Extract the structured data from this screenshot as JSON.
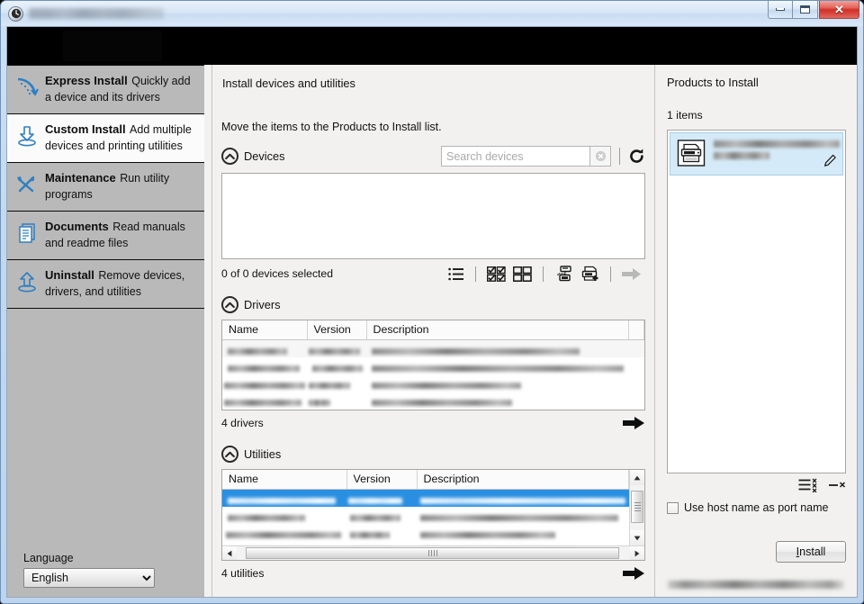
{
  "window": {
    "title_redacted": true,
    "icon": "app-clock-icon",
    "buttons": {
      "minimize": "–",
      "maximize": "□",
      "close": "✕"
    }
  },
  "sidebar": {
    "items": [
      {
        "title": "Express Install",
        "desc": "Quickly add a device and its drivers",
        "icon": "express-install-icon",
        "active": false
      },
      {
        "title": "Custom Install",
        "desc": "Add multiple devices and printing utilities",
        "icon": "custom-install-icon",
        "active": true
      },
      {
        "title": "Maintenance",
        "desc": "Run utility programs",
        "icon": "maintenance-icon",
        "active": false
      },
      {
        "title": "Documents",
        "desc": "Read manuals and readme files",
        "icon": "documents-icon",
        "active": false
      },
      {
        "title": "Uninstall",
        "desc": "Remove devices, drivers, and utilities",
        "icon": "uninstall-icon",
        "active": false
      }
    ],
    "language_label": "Language",
    "language_value": "English",
    "language_options": [
      "English"
    ]
  },
  "main": {
    "page_title": "Install devices and utilities",
    "hint": "Move the items to the Products to Install list.",
    "devices": {
      "section_label": "Devices",
      "search_placeholder": "Search devices",
      "search_value": "",
      "count_text": "0 of 0 devices selected",
      "rows": []
    },
    "drivers": {
      "section_label": "Drivers",
      "columns": [
        "Name",
        "Version",
        "Description"
      ],
      "count_text": "4 drivers",
      "rows": [
        {
          "name": "",
          "version": "",
          "description": "",
          "redacted": true,
          "selected": false
        },
        {
          "name": "",
          "version": "",
          "description": "",
          "redacted": true,
          "selected": false
        },
        {
          "name": "",
          "version": "",
          "description": "",
          "redacted": true,
          "selected": false
        },
        {
          "name": "",
          "version": "",
          "description": "",
          "redacted": true,
          "selected": false
        }
      ]
    },
    "utilities": {
      "section_label": "Utilities",
      "columns": [
        "Name",
        "Version",
        "Description"
      ],
      "count_text": "4 utilities",
      "rows": [
        {
          "name": "",
          "version": "",
          "description": "",
          "redacted": true,
          "selected": true
        },
        {
          "name": "",
          "version": "",
          "description": "",
          "redacted": true,
          "selected": false
        },
        {
          "name": "",
          "version": "",
          "description": "",
          "redacted": true,
          "selected": false
        },
        {
          "name": "",
          "version": "",
          "description": "",
          "redacted": true,
          "selected": false
        }
      ]
    }
  },
  "right": {
    "title": "Products to Install",
    "count_text": "1 items",
    "products": [
      {
        "name_redacted": true,
        "sub_redacted": true,
        "icon": "mfp-printer-icon",
        "selected": true
      }
    ],
    "checkbox_label": "Use host name as port name",
    "checkbox_checked": false,
    "install_label": "Install",
    "install_accel": "I"
  },
  "colors": {
    "selection_blue": "#2a8fe0",
    "card_blue": "#d5eaf8",
    "sidebar_gray": "#b9b9b9",
    "panel_gray": "#f2f1f0",
    "icon_blue": "#2f7fc1",
    "close_red": "#cf2f26"
  },
  "footer": {
    "redacted": true
  }
}
